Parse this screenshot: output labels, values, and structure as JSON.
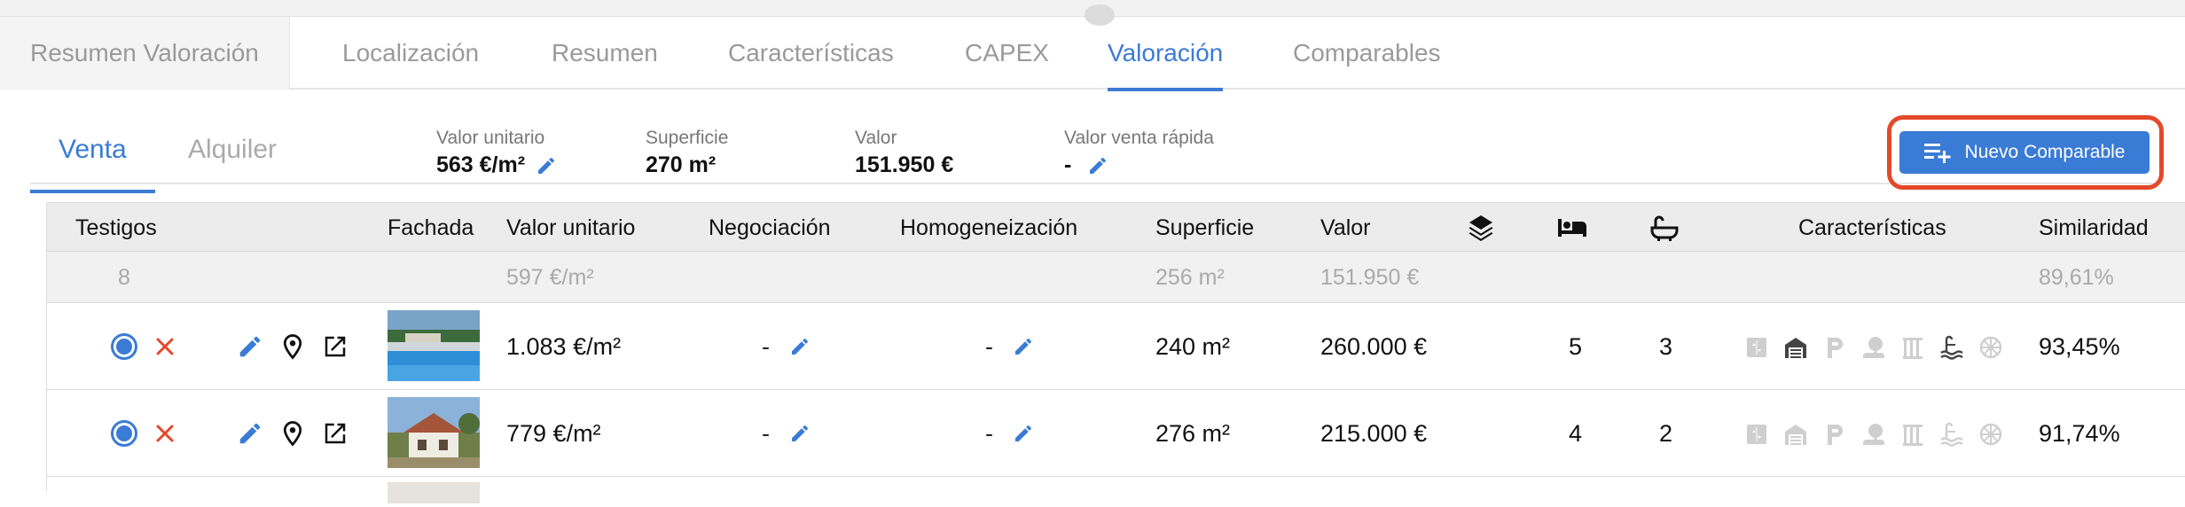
{
  "tabs": [
    "Resumen Valoración",
    "Localización",
    "Resumen",
    "Características",
    "CAPEX",
    "Valoración",
    "Comparables"
  ],
  "subtabs": [
    "Venta",
    "Alquiler"
  ],
  "metrics": [
    {
      "label": "Valor unitario",
      "value": "563 €/m²",
      "editable": true
    },
    {
      "label": "Superficie",
      "value": "270 m²",
      "editable": false
    },
    {
      "label": "Valor",
      "value": "151.950 €",
      "editable": false
    },
    {
      "label": "Valor venta rápida",
      "value": "-",
      "editable": true
    }
  ],
  "new_button": "Nuevo Comparable",
  "columns": {
    "testigos": "Testigos",
    "fachada": "Fachada",
    "valor_unitario": "Valor unitario",
    "negociacion": "Negociación",
    "homogeneizacion": "Homogeneización",
    "superficie": "Superficie",
    "valor": "Valor",
    "floors_icon": "layers-icon",
    "bed_icon": "bed-icon",
    "bath_icon": "bathtub-icon",
    "caracteristicas": "Características",
    "similaridad": "Similaridad"
  },
  "summary": {
    "count": "8",
    "valor_unitario": "597 €/m²",
    "superficie": "256 m²",
    "valor": "151.950 €",
    "similaridad": "89,61%"
  },
  "rows": [
    {
      "valor_unitario": "1.083 €/m²",
      "negociacion": "-",
      "homogeneizacion": "-",
      "superficie": "240 m²",
      "valor": "260.000 €",
      "plantas": "5",
      "banos": "3",
      "similaridad": "93,45%",
      "features_active": [
        false,
        true,
        false,
        false,
        false,
        true,
        false
      ]
    },
    {
      "valor_unitario": "779 €/m²",
      "negociacion": "-",
      "homogeneizacion": "-",
      "superficie": "276 m²",
      "valor": "215.000 €",
      "plantas": "4",
      "banos": "2",
      "similaridad": "91,74%",
      "features_active": [
        false,
        false,
        false,
        false,
        false,
        false,
        false
      ]
    }
  ],
  "colors": {
    "accent": "#3a7bd5",
    "danger": "#e4482a",
    "feature_active": "#444444",
    "feature_inactive": "#cfcfcf"
  }
}
